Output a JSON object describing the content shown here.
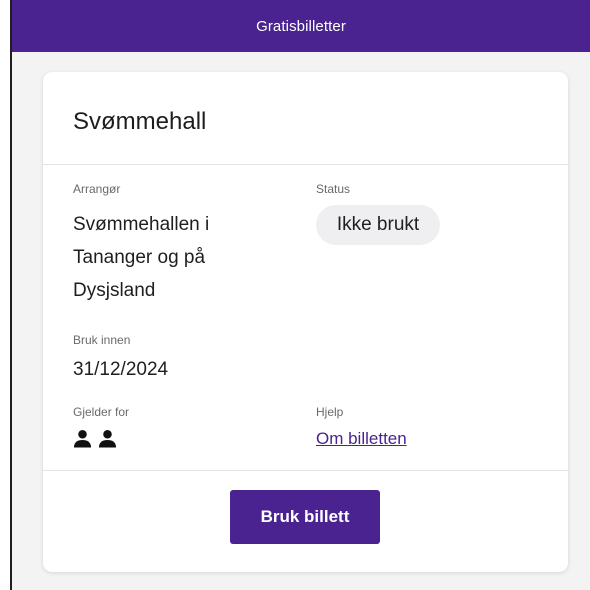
{
  "app": {
    "title": "Gratisbilletter"
  },
  "ticket": {
    "title": "Svømmehall",
    "organizer_label": "Arrangør",
    "organizer_lines": [
      "Svømmehallen i",
      "Tananger og på",
      "Dysjsland"
    ],
    "status_label": "Status",
    "status_value": "Ikke brukt",
    "use_before_label": "Bruk innen",
    "use_before_value": "31/12/2024",
    "applies_for_label": "Gjelder for",
    "applies_for_icons": [
      "person-icon",
      "person-icon"
    ],
    "help_label": "Hjelp",
    "help_link": "Om billetten",
    "use_button": "Bruk billett"
  },
  "colors": {
    "brand": "#4a2391",
    "background": "#f3f3f4",
    "pill": "#efeff1"
  }
}
